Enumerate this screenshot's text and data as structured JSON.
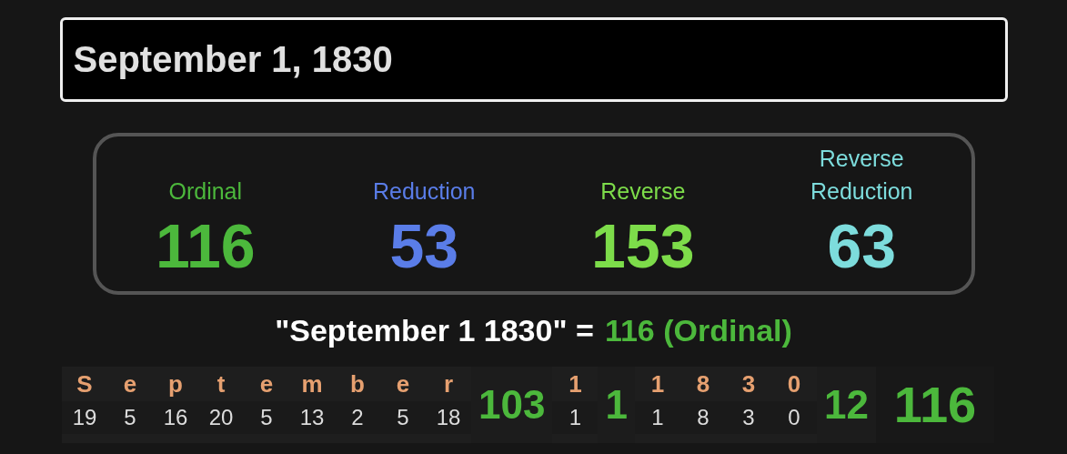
{
  "search": {
    "value": "September 1, 1830"
  },
  "ciphers": [
    {
      "label": "Ordinal",
      "value": "116",
      "color": "#4cb83c"
    },
    {
      "label": "Reduction",
      "value": "53",
      "color": "#5a7de8"
    },
    {
      "label": "Reverse",
      "value": "153",
      "color": "#7ddc4a"
    },
    {
      "label": "Reverse\nReduction",
      "value": "63",
      "color": "#7ddcdc"
    }
  ],
  "result": {
    "phrase": "\"September 1 1830\" =",
    "value": "116 (Ordinal)"
  },
  "breakdown": {
    "words": [
      {
        "letters": [
          {
            "char": "S",
            "value": "19"
          },
          {
            "char": "e",
            "value": "5"
          },
          {
            "char": "p",
            "value": "16"
          },
          {
            "char": "t",
            "value": "20"
          },
          {
            "char": "e",
            "value": "5"
          },
          {
            "char": "m",
            "value": "13"
          },
          {
            "char": "b",
            "value": "2"
          },
          {
            "char": "e",
            "value": "5"
          },
          {
            "char": "r",
            "value": "18"
          }
        ],
        "total": "103"
      },
      {
        "letters": [
          {
            "char": "1",
            "value": "1"
          }
        ],
        "total": "1"
      },
      {
        "letters": [
          {
            "char": "1",
            "value": "1"
          },
          {
            "char": "8",
            "value": "8"
          },
          {
            "char": "3",
            "value": "3"
          },
          {
            "char": "0",
            "value": "0"
          }
        ],
        "total": "12"
      }
    ],
    "total": "116"
  }
}
